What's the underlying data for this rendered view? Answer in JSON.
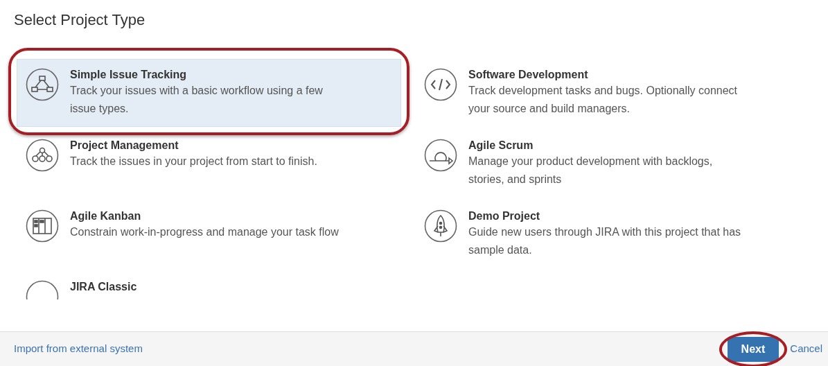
{
  "dialog": {
    "title": "Select Project Type"
  },
  "project_types": [
    {
      "kind": "workflow",
      "name": "Simple Issue Tracking",
      "description": "Track your issues with a basic workflow using a few issue types.",
      "selected": true,
      "annotated": true
    },
    {
      "kind": "code",
      "name": "Software Development",
      "description": "Track development tasks and bugs. Optionally connect your source and build managers.",
      "selected": false,
      "annotated": false
    },
    {
      "kind": "hierarchy",
      "name": "Project Management",
      "description": "Track the issues in your project from start to finish.",
      "selected": false,
      "annotated": false
    },
    {
      "kind": "loop",
      "name": "Agile Scrum",
      "description": "Manage your product development with backlogs, stories, and sprints",
      "selected": false,
      "annotated": false
    },
    {
      "kind": "board",
      "name": "Agile Kanban",
      "description": "Constrain work-in-progress and manage your task flow",
      "selected": false,
      "annotated": false
    },
    {
      "kind": "rocket",
      "name": "Demo Project",
      "description": "Guide new users through JIRA with this project that has sample data.",
      "selected": false,
      "annotated": false
    },
    {
      "kind": "classic",
      "name": "JIRA Classic",
      "selected": false,
      "annotated": false
    }
  ],
  "footer": {
    "import_link": "Import from external system",
    "next_button": {
      "label": "Next",
      "annotated": true
    },
    "cancel_link": "Cancel"
  }
}
